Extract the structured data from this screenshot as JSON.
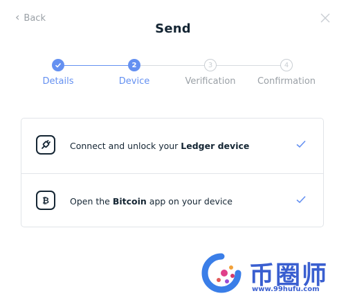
{
  "header": {
    "back_label": "Back",
    "title": "Send"
  },
  "stepper": {
    "steps": [
      {
        "index": "1",
        "label": "Details",
        "state": "done"
      },
      {
        "index": "2",
        "label": "Device",
        "state": "current"
      },
      {
        "index": "3",
        "label": "Verification",
        "state": "todo"
      },
      {
        "index": "4",
        "label": "Confirmation",
        "state": "todo"
      }
    ]
  },
  "device_steps": [
    {
      "text_before": "Connect and unlock your ",
      "bold": "Ledger device",
      "text_after": "",
      "icon": "usb-plug-icon",
      "checked": true
    },
    {
      "text_before": "Open the ",
      "bold": "Bitcoin",
      "text_after": " app on your device",
      "icon": "bitcoin-icon",
      "checked": true
    }
  ],
  "watermark": {
    "brand": "币圈师",
    "url": "www.99hufu.com"
  },
  "colors": {
    "accent": "#6490f1",
    "text": "#142533",
    "muted": "#9aa0a6",
    "border": "#e1e4e8"
  }
}
